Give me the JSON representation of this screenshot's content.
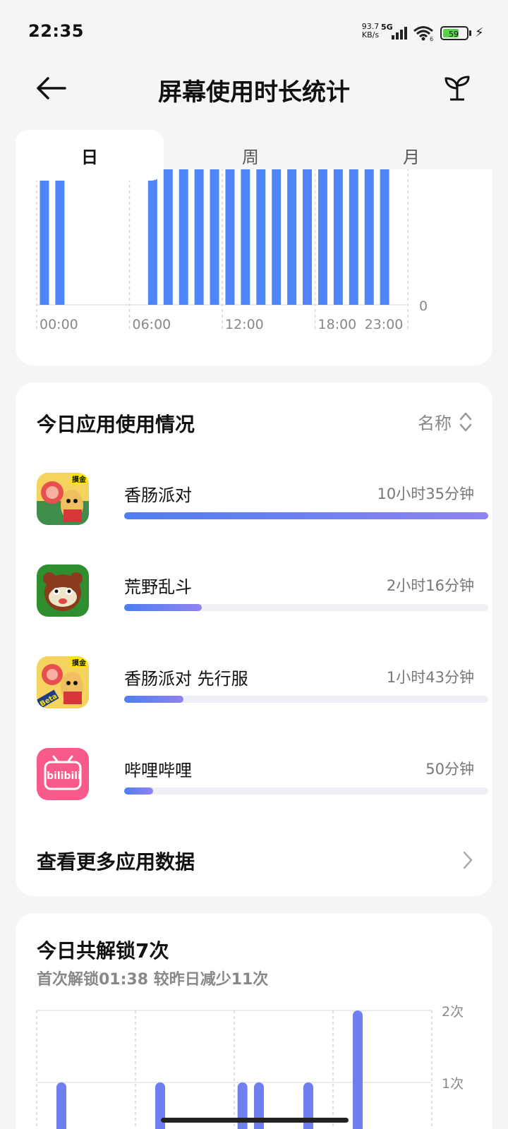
{
  "status_bar": {
    "time": "22:35",
    "net_speed_value": "93.7",
    "net_speed_unit": "KB/s",
    "network_type": "5G",
    "wifi_badge": "6",
    "battery_level": "59"
  },
  "header": {
    "title": "屏幕使用时长统计"
  },
  "tabs": [
    {
      "label": "日",
      "active": true
    },
    {
      "label": "周",
      "active": false
    },
    {
      "label": "月",
      "active": false
    }
  ],
  "usage_chart": {
    "x_tick_labels": [
      "00:00",
      "06:00",
      "12:00",
      "18:00",
      "23:00"
    ],
    "y_tick_label": "0",
    "bar_color": "#4f86f7",
    "active_hours": [
      0,
      1,
      7,
      8,
      9,
      10,
      11,
      12,
      13,
      14,
      15,
      16,
      17,
      18,
      19,
      20,
      21,
      22
    ]
  },
  "app_usage": {
    "title": "今日应用使用情况",
    "sort_label": "名称",
    "apps": [
      {
        "name": "香肠派对",
        "time": "10小时35分钟",
        "fraction": 1.0,
        "icon": "sausage-party-icon"
      },
      {
        "name": "荒野乱斗",
        "time": "2小时16分钟",
        "fraction": 0.214,
        "icon": "brawl-stars-icon"
      },
      {
        "name": "香肠派对 先行服",
        "time": "1小时43分钟",
        "fraction": 0.162,
        "icon": "sausage-party-beta-icon"
      },
      {
        "name": "哔哩哔哩",
        "time": "50分钟",
        "fraction": 0.079,
        "icon": "bilibili-icon"
      }
    ],
    "icon_badge_text": "摸金",
    "beta_badge_text": "Beta",
    "bilibili_logo_text": "bilibili",
    "more_label": "查看更多应用数据"
  },
  "unlocks": {
    "title": "今日共解锁7次",
    "subtitle": "首次解锁01:38 较昨日减少11次",
    "y_tick_labels": [
      "2次",
      "1次"
    ],
    "bar_color": "#6f7ff2",
    "chart_data": {
      "type": "bar",
      "x": [
        1,
        7,
        12,
        13,
        16,
        19
      ],
      "values": [
        1,
        1,
        1,
        1,
        1,
        2
      ],
      "ylim": [
        0,
        2
      ]
    }
  },
  "colors": {
    "accent": "#4f86f7",
    "accent_end": "#8f83f0",
    "track": "#eef0f5"
  }
}
